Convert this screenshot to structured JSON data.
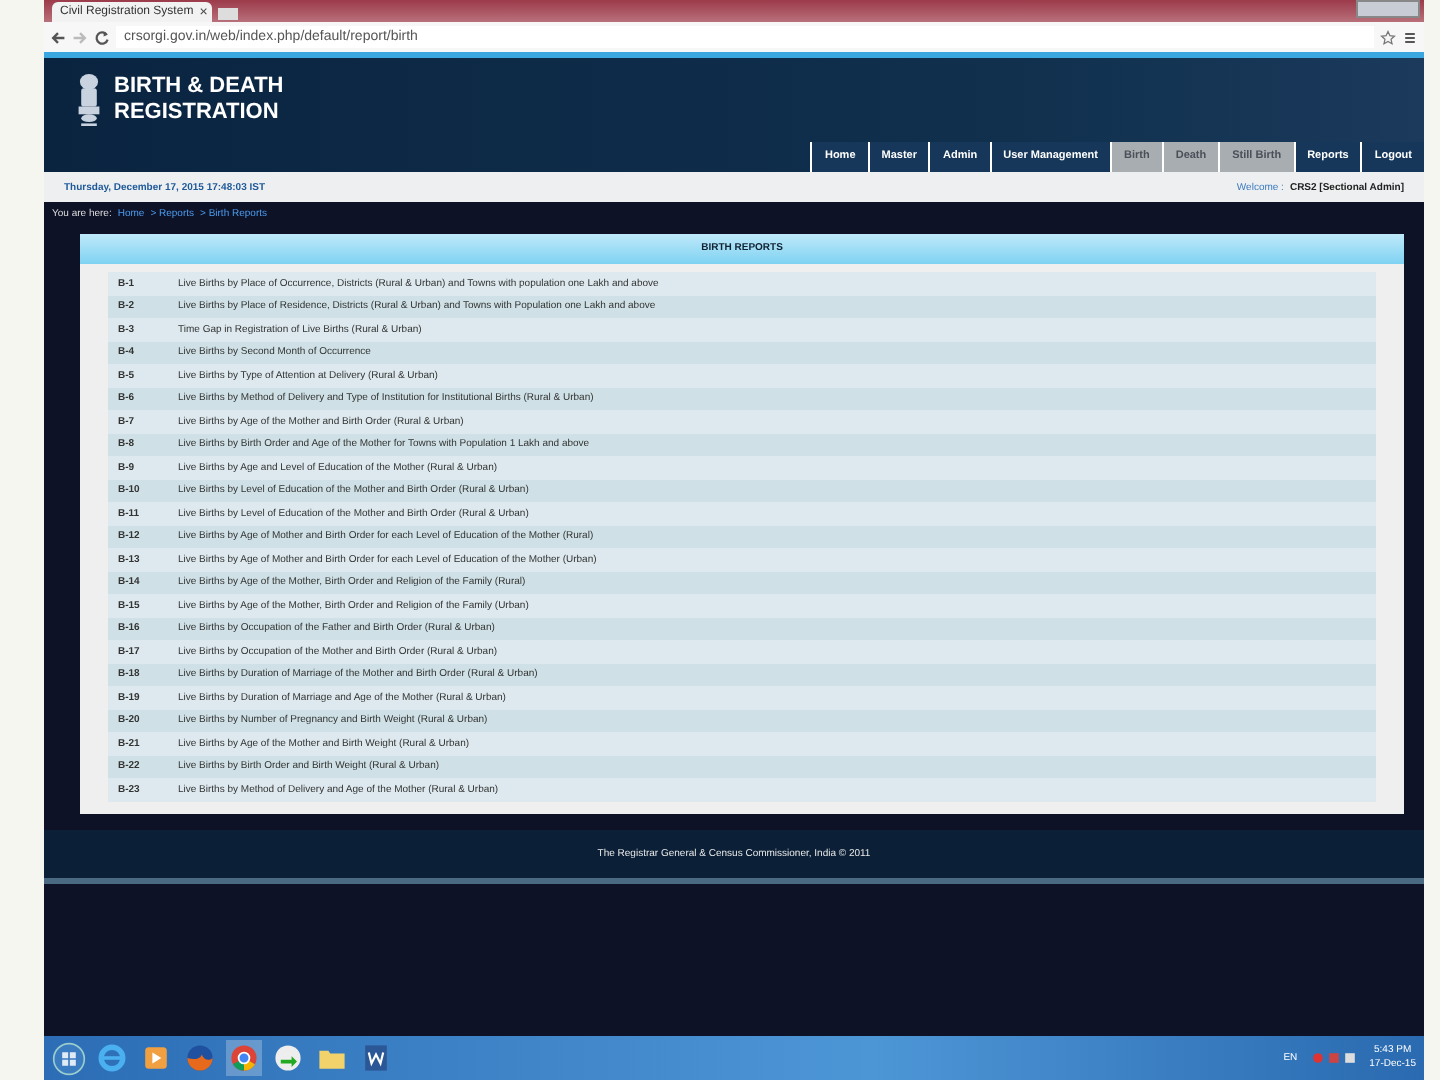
{
  "browser": {
    "tab_title": "Civil Registration System",
    "tab_close": "×",
    "url": "crsorgi.gov.in/web/index.php/default/report/birth"
  },
  "header": {
    "title_line_1": "BIRTH & DEATH",
    "title_line_2": "REGISTRATION"
  },
  "nav": [
    {
      "label": "Home",
      "disabled": false
    },
    {
      "label": "Master",
      "disabled": false
    },
    {
      "label": "Admin",
      "disabled": false
    },
    {
      "label": "User Management",
      "disabled": false
    },
    {
      "label": "Birth",
      "disabled": true
    },
    {
      "label": "Death",
      "disabled": true
    },
    {
      "label": "Still Birth",
      "disabled": true
    },
    {
      "label": "Reports",
      "disabled": false
    },
    {
      "label": "Logout",
      "disabled": false
    }
  ],
  "info_bar": {
    "datetime": "Thursday, December 17, 2015 17:48:03 IST",
    "welcome": "Welcome :",
    "user": "CRS2 [Sectional Admin]"
  },
  "breadcrumb": {
    "prefix": "You are here:",
    "items": [
      "Home",
      "> Reports",
      "> Birth Reports"
    ]
  },
  "reports": {
    "title": "BIRTH REPORTS",
    "rows": [
      {
        "code": "B-1",
        "name": "Live Births by Place of Occurrence, Districts (Rural & Urban) and Towns with population one Lakh and above"
      },
      {
        "code": "B-2",
        "name": "Live Births by Place of Residence, Districts (Rural & Urban) and Towns with Population one Lakh and above"
      },
      {
        "code": "B-3",
        "name": "Time Gap in Registration of Live Births (Rural & Urban)"
      },
      {
        "code": "B-4",
        "name": "Live Births by Second Month of Occurrence"
      },
      {
        "code": "B-5",
        "name": "Live Births by Type of Attention at Delivery (Rural & Urban)"
      },
      {
        "code": "B-6",
        "name": "Live Births by Method of Delivery and Type of Institution for Institutional Births (Rural & Urban)"
      },
      {
        "code": "B-7",
        "name": "Live Births by Age of the Mother and Birth Order (Rural & Urban)"
      },
      {
        "code": "B-8",
        "name": "Live Births by Birth Order and Age of the Mother for Towns with Population 1 Lakh and above"
      },
      {
        "code": "B-9",
        "name": "Live Births by Age and Level of Education of the Mother (Rural & Urban)"
      },
      {
        "code": "B-10",
        "name": "Live Births by Level of Education of the Mother and Birth Order (Rural & Urban)"
      },
      {
        "code": "B-11",
        "name": "Live Births by Level of Education of the Mother and Birth Order (Rural & Urban)"
      },
      {
        "code": "B-12",
        "name": "Live Births by Age of Mother and Birth Order for each Level of Education of the Mother (Rural)"
      },
      {
        "code": "B-13",
        "name": "Live Births by Age of Mother and Birth Order for each Level of Education of the Mother (Urban)"
      },
      {
        "code": "B-14",
        "name": "Live Births by Age of the Mother, Birth Order and Religion of the Family (Rural)"
      },
      {
        "code": "B-15",
        "name": "Live Births by Age of the Mother, Birth Order and Religion of the Family (Urban)"
      },
      {
        "code": "B-16",
        "name": "Live Births by Occupation of the Father and Birth Order (Rural & Urban)"
      },
      {
        "code": "B-17",
        "name": "Live Births by Occupation of the Mother and Birth Order (Rural & Urban)"
      },
      {
        "code": "B-18",
        "name": "Live Births by Duration of Marriage of the Mother and Birth Order (Rural & Urban)"
      },
      {
        "code": "B-19",
        "name": "Live Births by Duration of Marriage and Age of the Mother (Rural & Urban)"
      },
      {
        "code": "B-20",
        "name": "Live Births by Number of Pregnancy and Birth Weight (Rural & Urban)"
      },
      {
        "code": "B-21",
        "name": "Live Births by Age of the Mother and Birth Weight (Rural & Urban)"
      },
      {
        "code": "B-22",
        "name": "Live Births by Birth Order and Birth Weight (Rural & Urban)"
      },
      {
        "code": "B-23",
        "name": "Live Births by Method of Delivery and Age of the Mother (Rural & Urban)"
      }
    ]
  },
  "footer": "The Registrar General & Census Commissioner, India © 2011",
  "taskbar": {
    "language": "EN",
    "time": "5:43 PM",
    "date": "17-Dec-15"
  }
}
